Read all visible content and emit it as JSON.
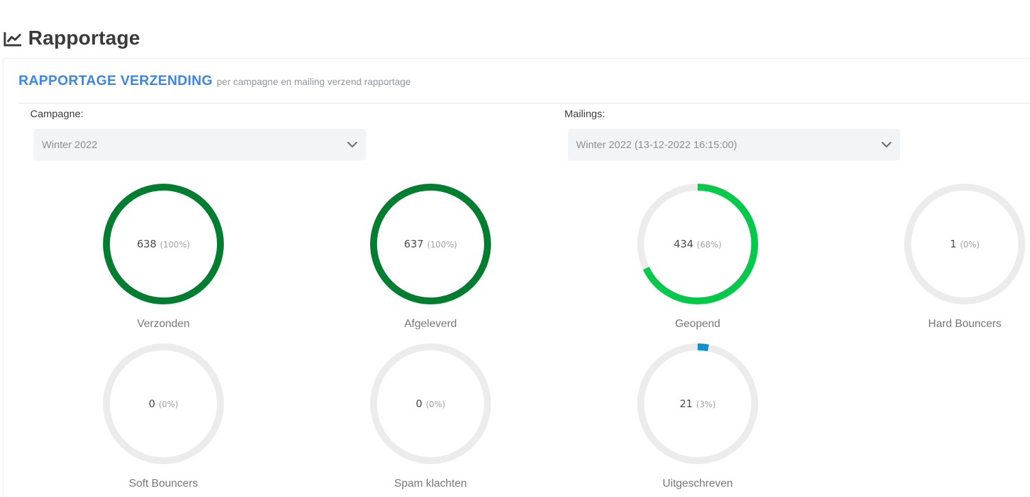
{
  "page": {
    "title": "Rapportage",
    "icon": "line-chart-icon"
  },
  "panel": {
    "title": "RAPPORTAGE VERZENDING",
    "subtitle": "per campagne en mailing verzend rapportage"
  },
  "filters": {
    "campaign": {
      "label": "Campagne:",
      "value": "Winter 2022",
      "icon": "chevron-down-icon"
    },
    "mailings": {
      "label": "Mailings:",
      "value": "Winter 2022 (13-12-2022 16:15:00)",
      "icon": "chevron-down-icon"
    }
  },
  "colors": {
    "track": "#ececec",
    "dark_green": "#037d2f",
    "bright_green": "#06c94c",
    "blue": "#1190d0",
    "accent": "#3b86e6"
  },
  "stats": [
    {
      "label": "Verzonden",
      "value": "638",
      "percent_text": "(100%)",
      "fraction": 1.0,
      "color": "#037d2f"
    },
    {
      "label": "Afgeleverd",
      "value": "637",
      "percent_text": "(100%)",
      "fraction": 1.0,
      "color": "#037d2f"
    },
    {
      "label": "Geopend",
      "value": "434",
      "percent_text": "(68%)",
      "fraction": 0.68,
      "color": "#06c94c"
    },
    {
      "label": "Hard Bouncers",
      "value": "1",
      "percent_text": "(0%)",
      "fraction": 0.0,
      "color": "#06c94c"
    },
    {
      "label": "Soft Bouncers",
      "value": "0",
      "percent_text": "(0%)",
      "fraction": 0.0,
      "color": "#06c94c"
    },
    {
      "label": "Spam klachten",
      "value": "0",
      "percent_text": "(0%)",
      "fraction": 0.0,
      "color": "#06c94c"
    },
    {
      "label": "Uitgeschreven",
      "value": "21",
      "percent_text": "(3%)",
      "fraction": 0.03,
      "color": "#1190d0"
    }
  ]
}
